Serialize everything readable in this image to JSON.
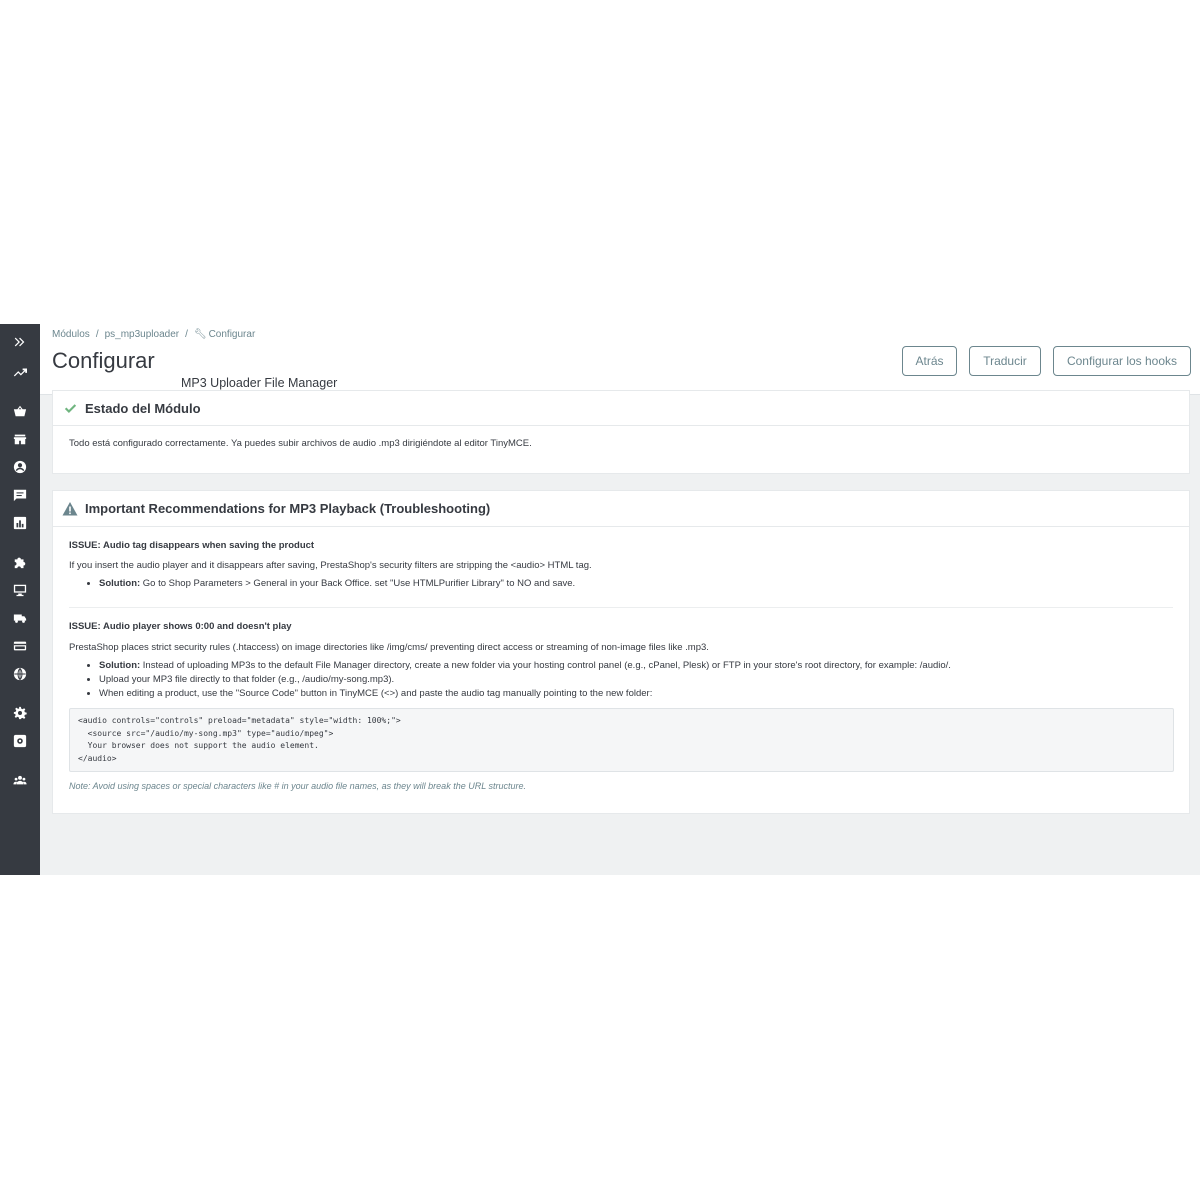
{
  "breadcrumb": {
    "item1": "Módulos",
    "item2": "ps_mp3uploader",
    "item3": "Configurar"
  },
  "page": {
    "title": "Configurar",
    "subtitle": "MP3 Uploader File Manager"
  },
  "toolbar": {
    "back_label": "Atrás",
    "translate_label": "Traducir",
    "hooks_label": "Configurar los hooks"
  },
  "sidebar": {
    "icons": [
      "expand-icon",
      "trending-icon",
      "basket-icon",
      "store-icon",
      "account-icon",
      "chat-icon",
      "chart-icon",
      "puzzle-icon",
      "desktop-icon",
      "truck-icon",
      "credit-card-icon",
      "globe-icon",
      "settings-icon",
      "settings-app-icon",
      "team-icon"
    ]
  },
  "status_panel": {
    "heading": "Estado del Módulo",
    "text": "Todo está configurado correctamente. Ya puedes subir archivos de audio .mp3 dirigiéndote al editor TinyMCE."
  },
  "rec_panel": {
    "heading": "Important Recommendations for MP3 Playback (Troubleshooting)",
    "issue1": {
      "title": "ISSUE: Audio tag disappears when saving the product",
      "text": "If you insert the audio player and it disappears after saving, PrestaShop's security filters are stripping the <audio> HTML tag.",
      "solution_label": "Solution:",
      "solution_text": " Go to Shop Parameters > General in your Back Office. set \"Use HTMLPurifier Library\" to NO and save."
    },
    "issue2": {
      "title": "ISSUE: Audio player shows 0:00 and doesn't play",
      "text": "PrestaShop places strict security rules (.htaccess) on image directories like /img/cms/ preventing direct access or streaming of non-image files like .mp3.",
      "solution_label": "Solution:",
      "solution_text": " Instead of uploading MP3s to the default File Manager directory, create a new folder via your hosting control panel (e.g., cPanel, Plesk) or FTP in your store's root directory, for example: /audio/.",
      "bullet2": "Upload your MP3 file directly to that folder (e.g., /audio/my-song.mp3).",
      "bullet3": "When editing a product, use the \"Source Code\" button in TinyMCE (<>) and paste the audio tag manually pointing to the new folder:"
    },
    "code": {
      "line1": "<audio controls=\"controls\" preload=\"metadata\" style=\"width: 100%;\">",
      "line2": "  <source src=\"/audio/my-song.mp3\" type=\"audio/mpeg\">",
      "line3": "  Your browser does not support the audio element.",
      "line4": "</audio>"
    },
    "note": "Note: Avoid using spaces or special characters like # in your audio file names, as they will break the URL structure."
  },
  "colors": {
    "sidebar": "#363a41",
    "background": "#eff1f2",
    "success": "#70b580",
    "warning": "#6c868e"
  }
}
